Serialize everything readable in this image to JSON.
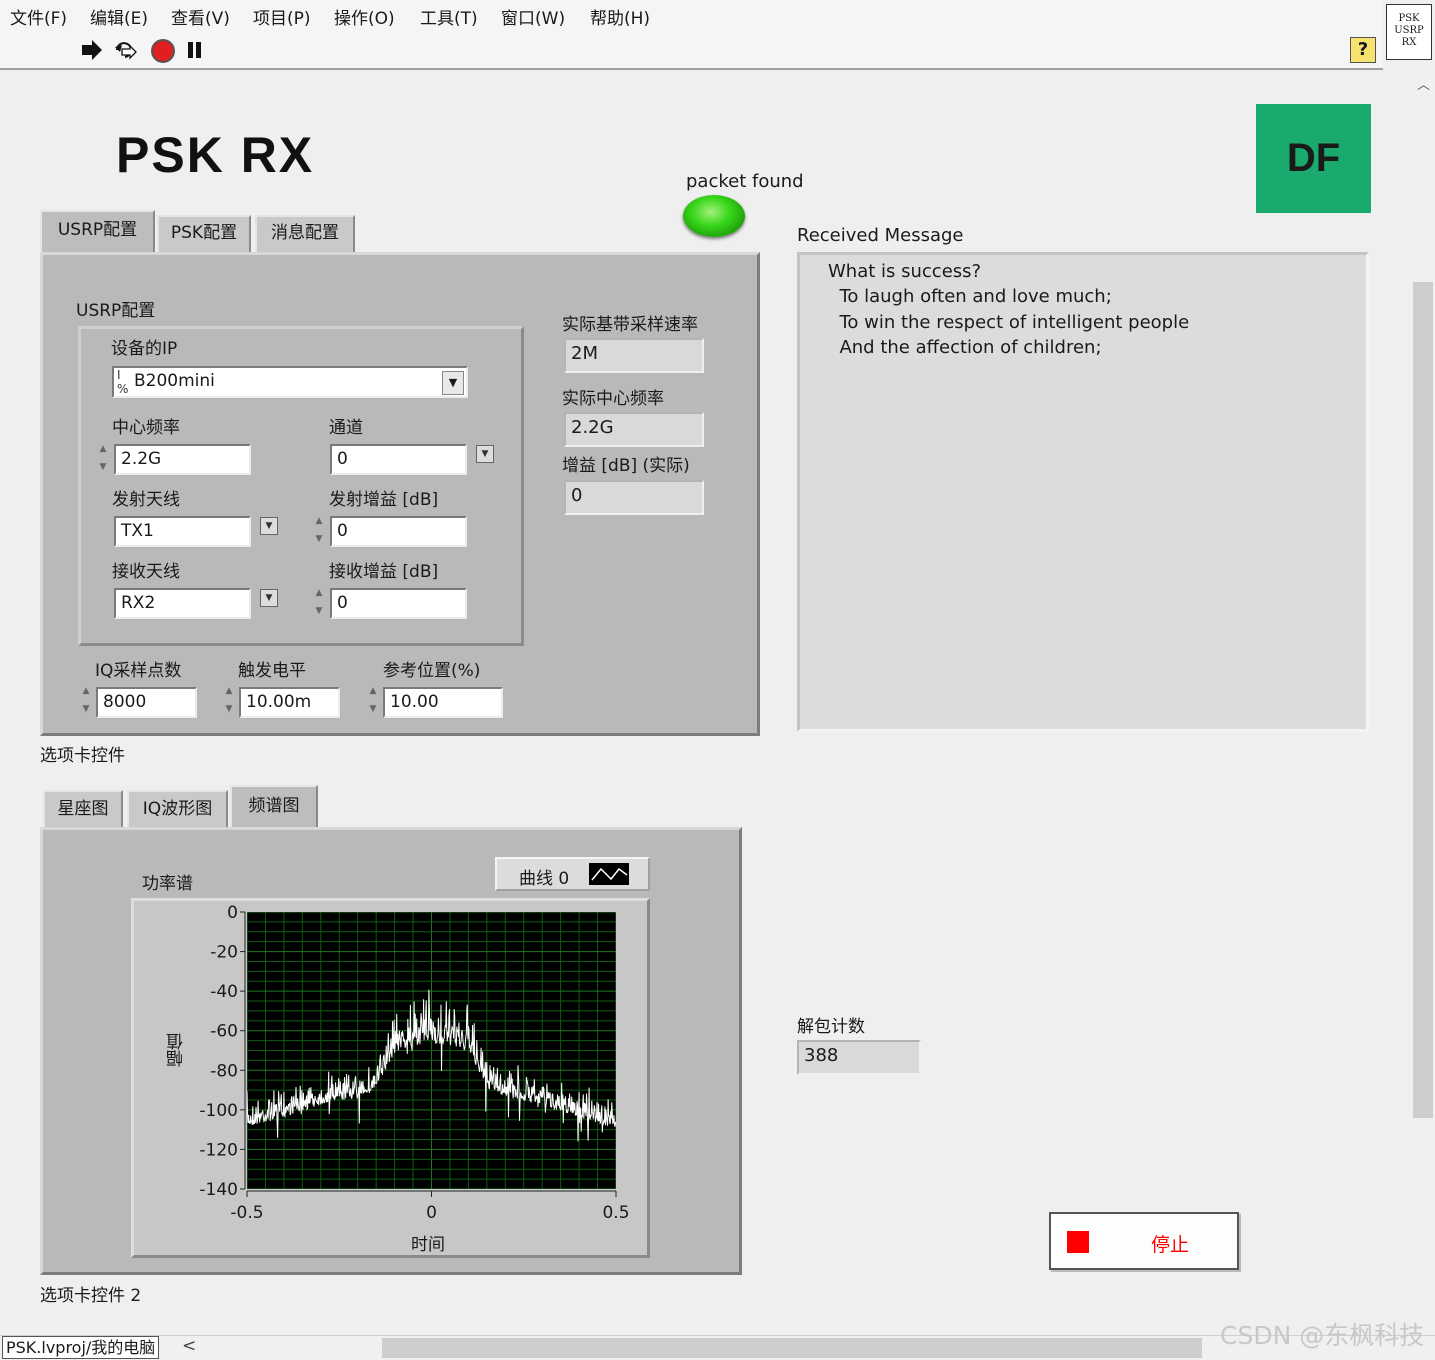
{
  "menu": [
    "文件(F)",
    "编辑(E)",
    "查看(V)",
    "项目(P)",
    "操作(O)",
    "工具(T)",
    "窗口(W)",
    "帮助(H)"
  ],
  "toolbar": {
    "run_icon": "run-arrow-icon",
    "run_continuous_icon": "run-continuous-icon",
    "abort_icon": "abort-icon",
    "pause_icon": "pause-icon",
    "help_label": "?"
  },
  "vi_icon_lines": [
    "PSK",
    "USRP",
    "RX"
  ],
  "title": "PSK  RX",
  "logo": "DF",
  "packet_found_label": "packet found",
  "tab_control_1": {
    "label": "选项卡控件",
    "tabs": [
      "USRP配置",
      "PSK配置",
      "消息配置"
    ],
    "active_tab": "USRP配置",
    "cluster_label": "USRP配置",
    "device_ip_label": "设备的IP",
    "device_ip_value": "B200mini",
    "center_freq_label": "中心频率",
    "center_freq_value": "2.2G",
    "channel_label": "通道",
    "channel_value": "0",
    "tx_antenna_label": "发射天线",
    "tx_antenna_value": "TX1",
    "tx_gain_label": "发射增益 [dB]",
    "tx_gain_value": "0",
    "rx_antenna_label": "接收天线",
    "rx_antenna_value": "RX2",
    "rx_gain_label": "接收增益 [dB]",
    "rx_gain_value": "0",
    "actual_rate_label": "实际基带采样速率",
    "actual_rate_value": "2M",
    "actual_center_label": "实际中心频率",
    "actual_center_value": "2.2G",
    "actual_gain_label": "增益 [dB] (实际)",
    "actual_gain_value": "0",
    "iq_samples_label": "IQ采样点数",
    "iq_samples_value": "8000",
    "trigger_level_label": "触发电平",
    "trigger_level_value": "10.00m",
    "ref_position_label": "参考位置(%)",
    "ref_position_value": "10.00"
  },
  "received_message": {
    "label": "Received Message",
    "lines": [
      "What is success?",
      "  To laugh often and love much;",
      "  To win the respect of intelligent people",
      "  And the affection of children;"
    ]
  },
  "tab_control_2": {
    "label": "选项卡控件 2",
    "tabs": [
      "星座图",
      "IQ波形图",
      "频谱图"
    ],
    "active_tab": "频谱图"
  },
  "chart_data": {
    "type": "line",
    "title": "功率谱",
    "xlabel": "时间",
    "ylabel": "幅值",
    "xlim": [
      -0.5,
      0.5
    ],
    "ylim": [
      -140,
      0
    ],
    "x_ticks": [
      "-0.5",
      "0",
      "0.5"
    ],
    "y_ticks": [
      "0",
      "-20",
      "-40",
      "-60",
      "-80",
      "-100",
      "-120",
      "-140"
    ],
    "grid": true,
    "legend": "top-right",
    "series": [
      {
        "name": "曲线 0",
        "color": "#ffffff",
        "profile_x": [
          -0.5,
          -0.4,
          -0.3,
          -0.2,
          -0.15,
          -0.1,
          -0.05,
          0,
          0.05,
          0.1,
          0.15,
          0.2,
          0.3,
          0.4,
          0.5
        ],
        "profile_y": [
          -105,
          -100,
          -94,
          -90,
          -86,
          -66,
          -62,
          -60,
          -62,
          -65,
          -85,
          -90,
          -94,
          -100,
          -106
        ],
        "peak_y": [
          -90,
          -85,
          -80,
          -75,
          -70,
          -45,
          -40,
          -36,
          -40,
          -44,
          -70,
          -75,
          -80,
          -85,
          -92
        ]
      }
    ]
  },
  "packet_count": {
    "label": "解包计数",
    "value": "388"
  },
  "stop_button": {
    "label": "停止",
    "color": "#ff0000"
  },
  "status_bar": {
    "project": "PSK.lvproj/我的电脑",
    "scroll_left": "<"
  },
  "watermark": "CSDN @东枫科技"
}
